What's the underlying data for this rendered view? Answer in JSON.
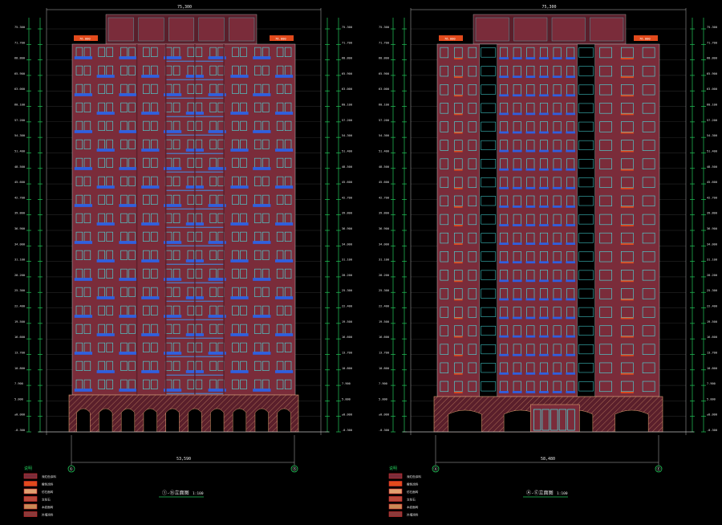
{
  "colors": {
    "background": "#000000",
    "facade": "#7a2c3a",
    "facade_dark": "#5a1f2b",
    "window_frame": "#49e3e3",
    "balcony": "#2f5fe0",
    "balcony_rail": "#3aa0ff",
    "grid_line": "#b9b9b9",
    "dim_line": "#22c95a",
    "parapet_orange": "#e24a1c",
    "legend_outline": "#d93030",
    "base_hatch": "#e0a070",
    "text_white": "#e8e8e8"
  },
  "left_drawing": {
    "top_dimension": "75,300",
    "roof_plate_left": "76.000",
    "roof_plate_right": "76.000",
    "bottom_dimension": "53,590",
    "axis_left": "①",
    "axis_right": "⑮",
    "title": "①-⑮立面图",
    "scale": "1:100",
    "floor_count": 19
  },
  "right_drawing": {
    "top_dimension": "75,300",
    "roof_plate_left": "76.000",
    "roof_plate_right": "76.000",
    "bottom_dimension": "58,480",
    "axis_left": "Ⓐ",
    "axis_right": "Ⓔ",
    "title": "Ⓐ-Ⓔ立面图",
    "scale": "1:100",
    "floor_count": 19
  },
  "elevation_labels": [
    "75.300",
    "71.700",
    "68.800",
    "65.900",
    "63.000",
    "60.100",
    "57.200",
    "54.300",
    "51.400",
    "48.500",
    "45.600",
    "42.700",
    "39.800",
    "36.900",
    "34.000",
    "31.100",
    "28.200",
    "25.300",
    "22.400",
    "19.500",
    "16.600",
    "13.700",
    "10.800",
    "7.900",
    "5.000",
    "±0.000",
    "-0.300"
  ],
  "legend": {
    "heading": "说明",
    "items": [
      {
        "swatch": "#7a2c3a",
        "label": "深红色涂料"
      },
      {
        "swatch": "#e24a1c",
        "label": "橙色涂料"
      },
      {
        "swatch": "#e0a070",
        "label": "仿石面砖"
      },
      {
        "swatch": "#b8483a",
        "label": "文化石"
      },
      {
        "swatch": "#c98a55",
        "label": "木纹面砖"
      },
      {
        "swatch": "#8b3a3a",
        "label": "外墙涂料"
      }
    ]
  }
}
